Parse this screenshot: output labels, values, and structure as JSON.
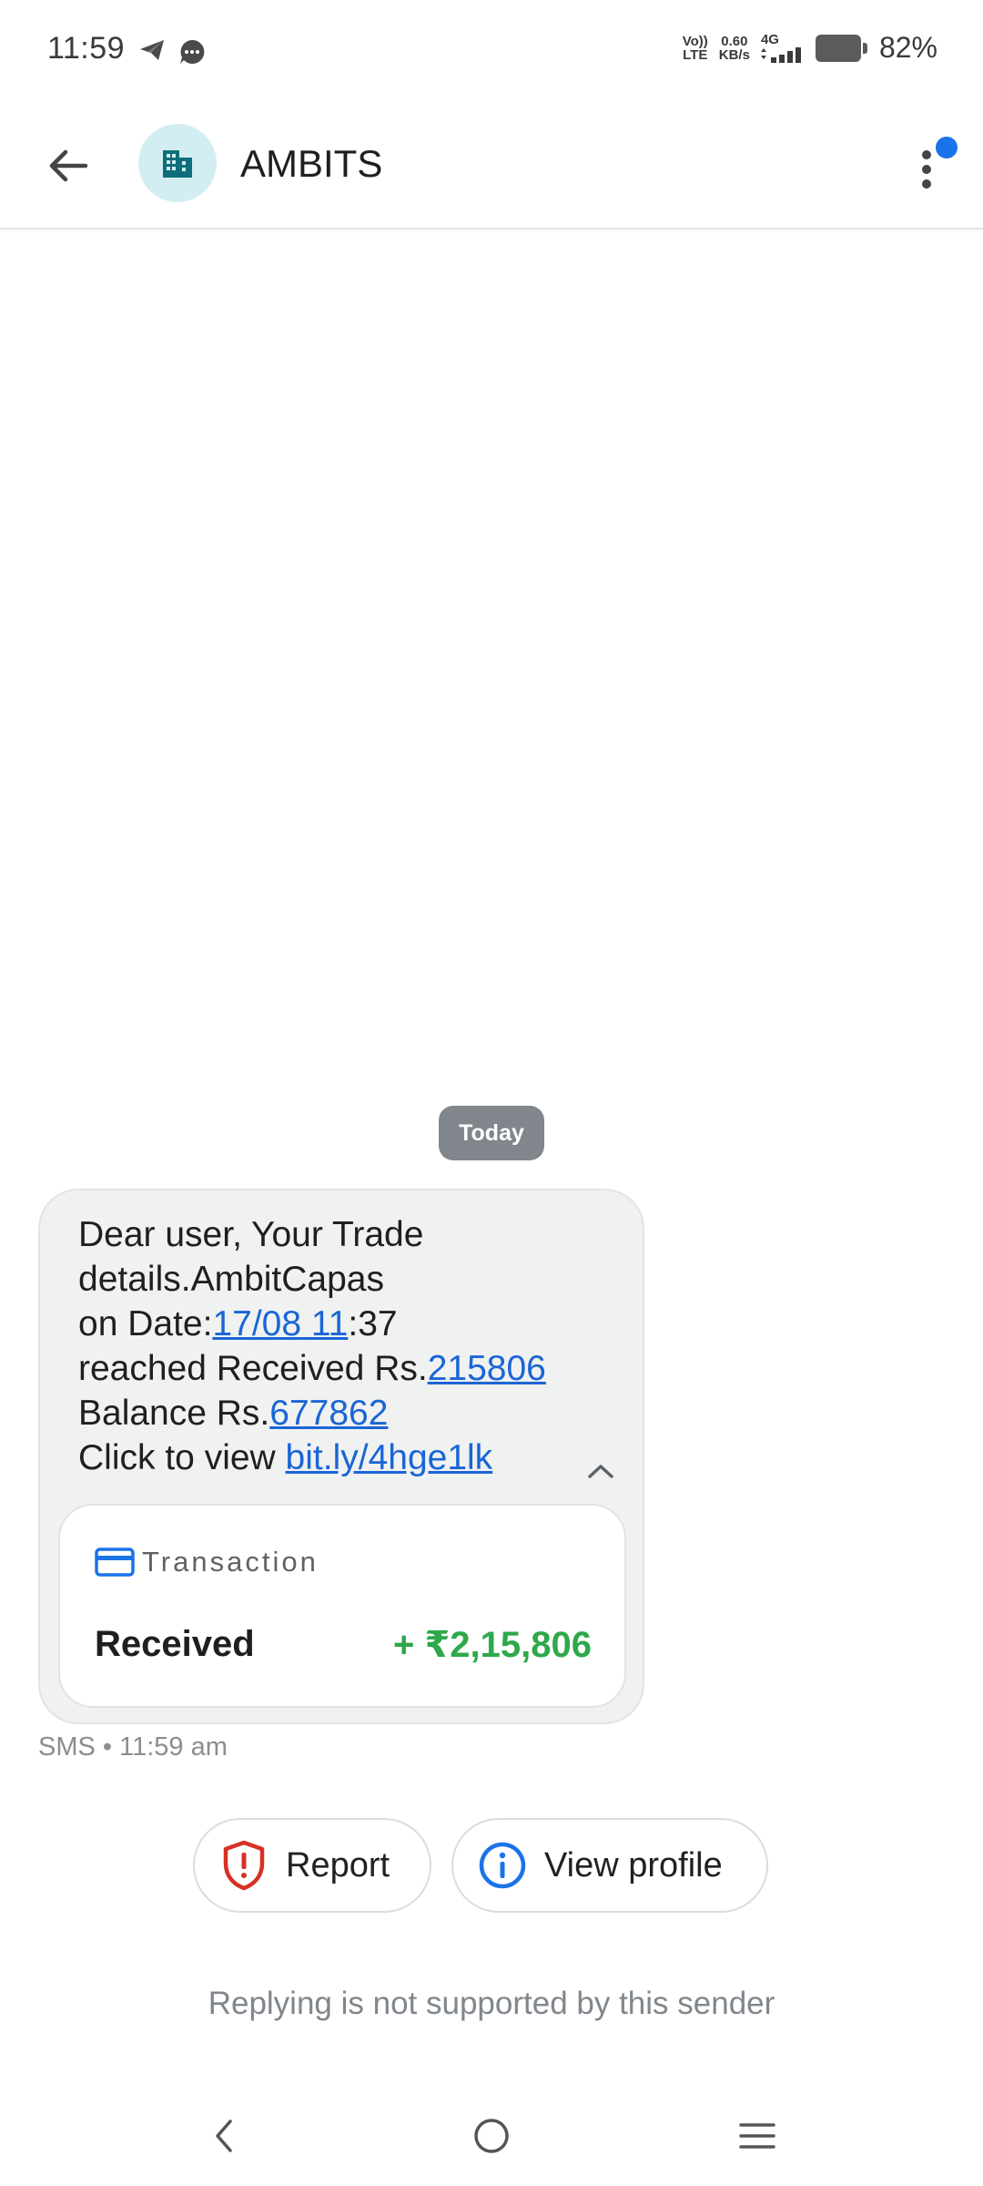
{
  "status_bar": {
    "time": "11:59",
    "volte_top": "Vo))",
    "volte_bottom": "LTE",
    "speed_value": "0.60",
    "speed_unit": "KB/s",
    "network": "4G",
    "battery": "82%"
  },
  "header": {
    "sender": "AMBITS",
    "avatar_icon": "building-icon",
    "has_notification": true
  },
  "conversation": {
    "date_chip": "Today",
    "message": {
      "line1": "Dear user, Your Trade",
      "line2": "details.AmbitCapas",
      "line3_prefix": "on Date:",
      "line3_link": "17/08 11",
      "line3_suffix": ":37",
      "line4_prefix": "reached Received Rs.",
      "line4_link": "215806",
      "line5_prefix": "Balance Rs.",
      "line5_link": "677862",
      "line6_prefix": "Click to view ",
      "line6_link": "bit.ly/4hge1lk"
    },
    "transaction": {
      "title": "Transaction",
      "label": "Received",
      "amount": "+ ₹2,15,806"
    },
    "meta": "SMS • 11:59 am"
  },
  "actions": {
    "report": "Report",
    "view_profile": "View profile"
  },
  "footer": {
    "reply_note": "Replying is not supported by this sender"
  },
  "colors": {
    "link": "#1a65d6",
    "amount_positive": "#2ea84a",
    "report_icon": "#d93025",
    "info_icon": "#1a73e8",
    "avatar_bg": "#d3eef2",
    "avatar_fg": "#0e6e7a"
  }
}
